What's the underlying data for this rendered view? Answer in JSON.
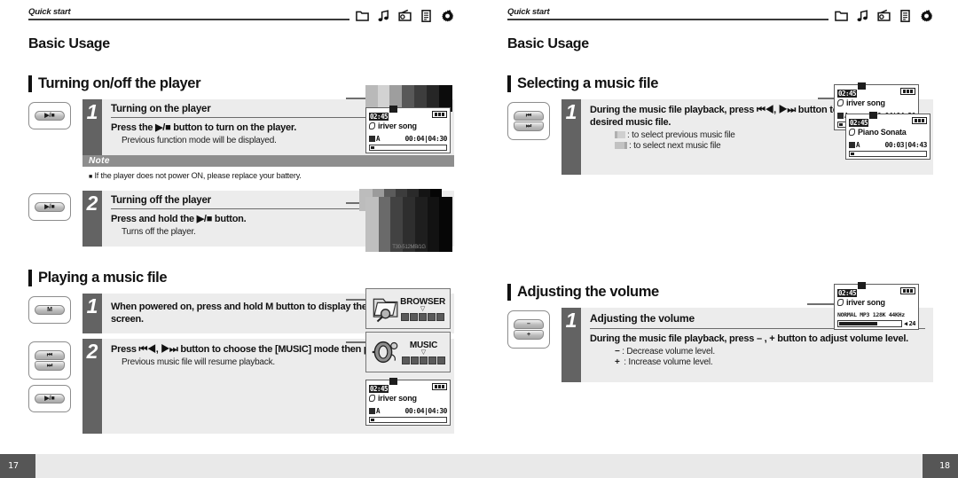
{
  "left_page": {
    "header": {
      "kicker": "Quick start",
      "title": "Basic Usage",
      "icons": [
        "folder-icon",
        "music-note-icon",
        "fm-radio-icon",
        "text-viewer-icon",
        "settings-gear-icon"
      ]
    },
    "sections": [
      {
        "title": "Turning on/off the player",
        "steps": [
          {
            "number": "1",
            "button_labels": [
              "▶/■"
            ],
            "title": "Turning on the player",
            "main": "Press the ▶/■ button to turn on the player.",
            "sub": "Previous function mode will be displayed."
          },
          {
            "number": "2",
            "button_labels": [
              "▶/■"
            ],
            "title": "Turning off the player",
            "main": "Press and hold the ▶/■ button.",
            "sub": "Turns off the player."
          }
        ],
        "note": {
          "label": "Note",
          "text": "If the player does not power ON, please replace your battery."
        }
      },
      {
        "title": "Playing a music file",
        "steps": [
          {
            "number": "1",
            "button_labels": [
              "M"
            ],
            "main": "When powered on, press and hold M button to display the function mode screen.",
            "sub": ""
          },
          {
            "number": "2",
            "button_labels": [
              "⏮",
              "⏭",
              "▶/■"
            ],
            "main": "Press ⏮◀, ▶⏭ button to choose the [MUSIC] mode then press ▶/■ button.",
            "sub": "Previous music file will resume playback."
          }
        ]
      }
    ],
    "lcd_screens": [
      {
        "id": "lcd-power-on",
        "clock": "02:45",
        "song": "iriver song",
        "repeat": "A",
        "time": "00:04|04:30",
        "progress_percent": 5
      },
      {
        "id": "lcd-music-resume",
        "clock": "02:45",
        "song": "iriver song",
        "repeat": "A",
        "time": "00:04|04:30",
        "progress_percent": 5
      }
    ],
    "mode_tiles": [
      {
        "id": "tile-browser",
        "label": "BROWSER",
        "icon": "folder-magnifier-icon"
      },
      {
        "id": "tile-music",
        "label": "MUSIC",
        "icon": "headphones-icon"
      }
    ],
    "device_caption": "T30-512MB/1G"
  },
  "right_page": {
    "header": {
      "kicker": "Quick start",
      "title": "Basic Usage",
      "icons": [
        "folder-icon",
        "music-note-icon",
        "fm-radio-icon",
        "text-viewer-icon",
        "settings-gear-icon"
      ]
    },
    "sections": [
      {
        "title": "Selecting a music file",
        "steps": [
          {
            "number": "1",
            "button_labels": [
              "⏮",
              "⏭"
            ],
            "main": "During the music file playback, press ⏮◀, ▶⏭ button to choose the desired music file.",
            "sub_items": [
              {
                "glyph": "prev-track-icon",
                "text": ": to select previous music file"
              },
              {
                "glyph": "next-track-icon",
                "text": ": to select next music file"
              }
            ]
          }
        ]
      },
      {
        "title": "Adjusting the volume",
        "steps": [
          {
            "number": "1",
            "button_labels": [
              "–",
              "+"
            ],
            "title": "Adjusting the volume",
            "main": "During the music file playback, press – , + button to adjust volume level.",
            "sub_items": [
              {
                "glyph": "minus-icon",
                "text": ": Decrease volume level."
              },
              {
                "glyph": "plus-icon",
                "text": ": Increase volume level."
              }
            ]
          }
        ]
      }
    ],
    "lcd_screens": [
      {
        "id": "lcd-current-track",
        "clock": "02:45",
        "song": "iriver song",
        "repeat": "A",
        "time": "00:04|04:30",
        "progress_percent": 5
      },
      {
        "id": "lcd-next-track",
        "clock": "02:45",
        "song": "Piano Sonata",
        "repeat": "A",
        "time": "00:03|04:43",
        "progress_percent": 5
      },
      {
        "id": "lcd-volume",
        "clock": "02:45",
        "song": "iriver song",
        "meta": "NORMAL MP3 128K 44KHz",
        "volume_value": "24",
        "volume_percent": 62
      }
    ]
  },
  "footer": {
    "left_page_number": "17",
    "right_page_number": "18"
  },
  "colors": {
    "body_bg": "#ececec",
    "number_col": "#636363",
    "note_band": "#8e8e8e",
    "footer_bg": "#e9e9e9",
    "page_num_bg": "#565656"
  }
}
